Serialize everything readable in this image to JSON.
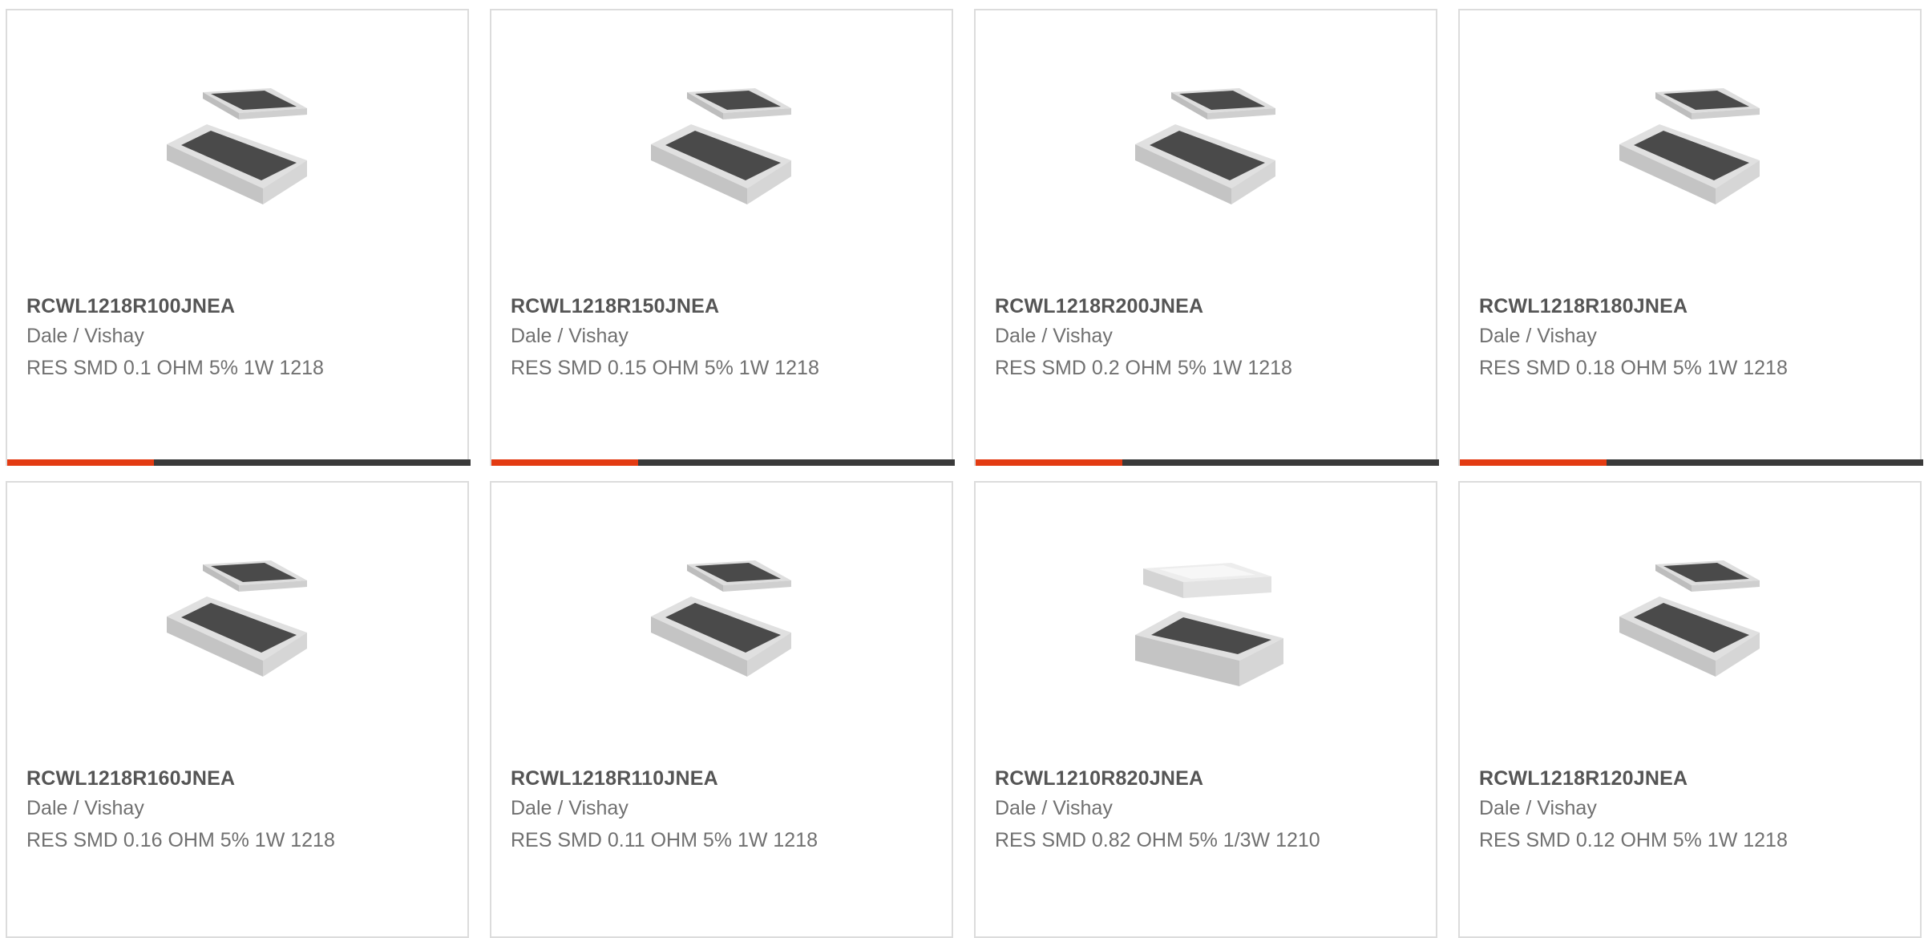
{
  "colors": {
    "accent": "#e33b12",
    "bar": "#3a3a3a",
    "border": "#dcdcdc"
  },
  "products": [
    {
      "part_number": "RCWL1218R100JNEA",
      "manufacturer": "Dale / Vishay",
      "description": "RES SMD 0.1 OHM 5% 1W 1218",
      "image_icon": "resistor-chip-image"
    },
    {
      "part_number": "RCWL1218R150JNEA",
      "manufacturer": "Dale / Vishay",
      "description": "RES SMD 0.15 OHM 5% 1W 1218",
      "image_icon": "resistor-chip-image"
    },
    {
      "part_number": "RCWL1218R200JNEA",
      "manufacturer": "Dale / Vishay",
      "description": "RES SMD 0.2 OHM 5% 1W 1218",
      "image_icon": "resistor-chip-image"
    },
    {
      "part_number": "RCWL1218R180JNEA",
      "manufacturer": "Dale / Vishay",
      "description": "RES SMD 0.18 OHM 5% 1W 1218",
      "image_icon": "resistor-chip-image"
    },
    {
      "part_number": "RCWL1218R160JNEA",
      "manufacturer": "Dale / Vishay",
      "description": "RES SMD 0.16 OHM 5% 1W 1218",
      "image_icon": "resistor-chip-image"
    },
    {
      "part_number": "RCWL1218R110JNEA",
      "manufacturer": "Dale / Vishay",
      "description": "RES SMD 0.11 OHM 5% 1W 1218",
      "image_icon": "resistor-chip-image"
    },
    {
      "part_number": "RCWL1210R820JNEA",
      "manufacturer": "Dale / Vishay",
      "description": "RES SMD 0.82 OHM 5% 1/3W 1210",
      "image_icon": "resistor-chip-image"
    },
    {
      "part_number": "RCWL1218R120JNEA",
      "manufacturer": "Dale / Vishay",
      "description": "RES SMD 0.12 OHM 5% 1W 1218",
      "image_icon": "resistor-chip-image"
    }
  ]
}
